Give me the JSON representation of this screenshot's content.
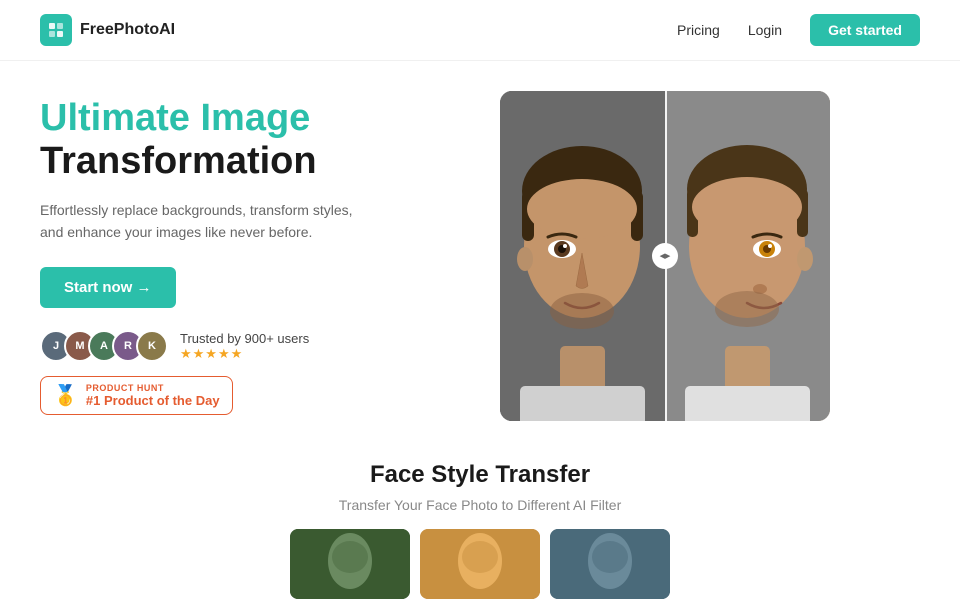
{
  "brand": {
    "name": "FreePhotoAI",
    "logo_char": "✦"
  },
  "nav": {
    "pricing": "Pricing",
    "login": "Login",
    "get_started": "Get started"
  },
  "hero": {
    "title_highlight": "Ultimate Image",
    "title_dark": "Transformation",
    "subtitle": "Effortlessly replace backgrounds, transform styles, and enhance your images like never before.",
    "cta": "Start now →"
  },
  "trust": {
    "text": "Trusted by 900+ users",
    "stars": "★★★★★"
  },
  "product_hunt": {
    "label": "PRODUCT HUNT",
    "value": "#1 Product of the Day"
  },
  "feature": {
    "title": "Face Style Transfer",
    "subtitle": "Transfer Your Face Photo to Different AI Filter"
  },
  "avatars": [
    {
      "initials": "J",
      "color": "#5a6a7a"
    },
    {
      "initials": "M",
      "color": "#8a5a4a"
    },
    {
      "initials": "A",
      "color": "#4a8a5a"
    },
    {
      "initials": "R",
      "color": "#7a5a8a"
    },
    {
      "initials": "K",
      "color": "#6a7a4a"
    }
  ]
}
